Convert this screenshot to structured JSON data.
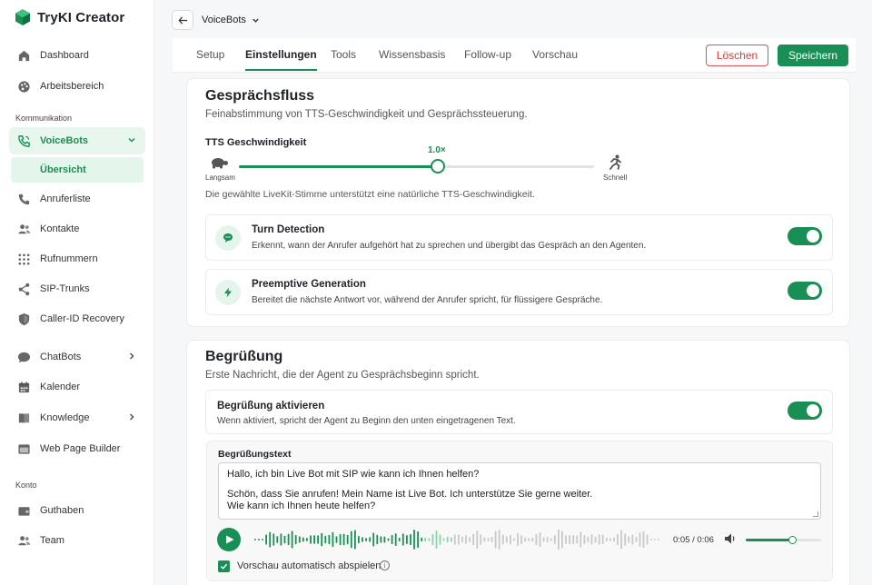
{
  "app": {
    "title": "TryKI Creator"
  },
  "sidebar": {
    "items": [
      {
        "label": "Dashboard",
        "icon": "home-icon"
      },
      {
        "label": "Arbeitsbereich",
        "icon": "palette-icon"
      }
    ],
    "section_kommunikation": "Kommunikation",
    "voicebots": {
      "label": "VoiceBots",
      "icon": "phone-icon",
      "sub": "Übersicht"
    },
    "comm_items": [
      {
        "label": "Anruferliste",
        "icon": "phone-call-icon"
      },
      {
        "label": "Kontakte",
        "icon": "contacts-icon"
      },
      {
        "label": "Rufnummern",
        "icon": "dialpad-icon"
      },
      {
        "label": "SIP-Trunks",
        "icon": "share-icon"
      },
      {
        "label": "Caller-ID Recovery",
        "icon": "shield-icon"
      },
      {
        "label": "ChatBots",
        "icon": "chat-icon"
      },
      {
        "label": "Kalender",
        "icon": "calendar-icon"
      },
      {
        "label": "Knowledge",
        "icon": "book-icon"
      },
      {
        "label": "Web Page Builder",
        "icon": "browser-icon"
      }
    ],
    "section_konto": "Konto",
    "account_items": [
      {
        "label": "Guthaben",
        "icon": "wallet-icon"
      },
      {
        "label": "Team",
        "icon": "team-icon"
      }
    ]
  },
  "header": {
    "bot_name": "VoiceBots"
  },
  "tabs": [
    "Setup",
    "Einstellungen",
    "Tools",
    "Wissensbasis",
    "Follow-up",
    "Vorschau"
  ],
  "actions": {
    "delete": "Löschen",
    "save": "Speichern"
  },
  "flow": {
    "title": "Gesprächsfluss",
    "desc": "Feinabstimmung von TTS-Geschwindigkeit und Gesprächssteuerung.",
    "tts_label": "TTS Geschwindigkeit",
    "tts_value": "1.0×",
    "tts_fraction": 0.56,
    "slow_label": "Langsam",
    "fast_label": "Schnell",
    "hint": "Die gewählte LiveKit-Stimme unterstützt eine natürliche TTS-Geschwindigkeit.",
    "options": [
      {
        "title": "Turn Detection",
        "desc": "Erkennt, wann der Anrufer aufgehört hat zu sprechen und übergibt das Gespräch an den Agenten.",
        "enabled": true
      },
      {
        "title": "Preemptive Generation",
        "desc": "Bereitet die nächste Antwort vor, während der Anrufer spricht, für flüssigere Gespräche.",
        "enabled": true
      }
    ]
  },
  "greeting": {
    "title": "Begrüßung",
    "desc": "Erste Nachricht, die der Agent zu Gesprächsbeginn spricht.",
    "enable_title": "Begrüßung aktivieren",
    "enable_desc": "Wenn aktiviert, spricht der Agent zu Beginn den unten eingetragenen Text.",
    "enabled": true,
    "text_label": "Begrüßungstext",
    "text_line1": "Hallo, ich bin Live Bot mit SIP wie kann ich Ihnen helfen?",
    "text_line2": "Schön, dass Sie anrufen! Mein Name ist Live Bot. Ich unterstütze Sie gerne weiter.",
    "text_line3": "Wie kann ich Ihnen heute helfen?",
    "time": "0:05 / 0:06",
    "playback_fraction": 0.42,
    "volume_fraction": 0.62,
    "autoplay_label": "Vorschau automatisch abspielen",
    "autoplay_checked": true
  },
  "colors": {
    "accent": "#1a8f55",
    "danger": "#d83b3b"
  }
}
